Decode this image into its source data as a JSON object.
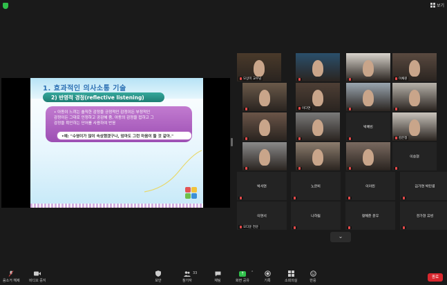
{
  "topbar": {
    "view_label": "보기"
  },
  "slide": {
    "title": "1. 효과적인 의사소통 기술",
    "subtitle": "2) 반영적 경청(reflective listening)",
    "body_line1": "• 아동이 느끼는 솔직한 감정을 긍정적인 감정이든 부정적인",
    "body_line2": "  감정이든 그대로 인정하고 공감해 줌, 아동의 감정을 접하고 그",
    "body_line3": "  감정을 확인하는 단어를 사용하여 반응",
    "example": "•예: \"수영이가 많이 속상했겠구나, 엄마도 그런 마음이 들 것 같아.\""
  },
  "gallery": {
    "tiles": [
      {
        "label": "모상미 교수님",
        "name": ""
      },
      {
        "label": "",
        "name": ""
      },
      {
        "label": "",
        "name": ""
      },
      {
        "label": "이채원",
        "name": ""
      },
      {
        "label": "",
        "name": ""
      },
      {
        "label": "이다연",
        "name": ""
      },
      {
        "label": "",
        "name": ""
      },
      {
        "label": "",
        "name": ""
      },
      {
        "label": "",
        "name": ""
      },
      {
        "label": "",
        "name": ""
      },
      {
        "label": "",
        "name": "박혜빈"
      },
      {
        "label": "김은정",
        "name": ""
      },
      {
        "label": "",
        "name": ""
      },
      {
        "label": "",
        "name": ""
      },
      {
        "label": "",
        "name": ""
      },
      {
        "label": "",
        "name": "이승현"
      },
      {
        "label": "",
        "name": "박서연"
      },
      {
        "label": "",
        "name": "노은비"
      },
      {
        "label": "",
        "name": "이아린"
      },
      {
        "label": "",
        "name": "김가연 박민영"
      },
      {
        "label": "오다운 연운",
        "name": "이연서"
      },
      {
        "label": "",
        "name": "나하림"
      },
      {
        "label": "",
        "name": "정해준 윤우"
      },
      {
        "label": "",
        "name": "전가현 유빈"
      }
    ],
    "more_glyph": "⌄"
  },
  "toolbar": {
    "audio_label": "음소거 해제",
    "video_label": "비디오 중지",
    "security_label": "보안",
    "participants_label": "참가자",
    "participants_count": "33",
    "chat_label": "채팅",
    "share_label": "화면 공유",
    "record_label": "기록",
    "breakout_label": "소회의실",
    "reactions_label": "반응",
    "end_label": "종료"
  },
  "colors": {
    "accent_green": "#2fbf4a",
    "end_red": "#d9272e",
    "active_speaker": "#e3d237"
  }
}
